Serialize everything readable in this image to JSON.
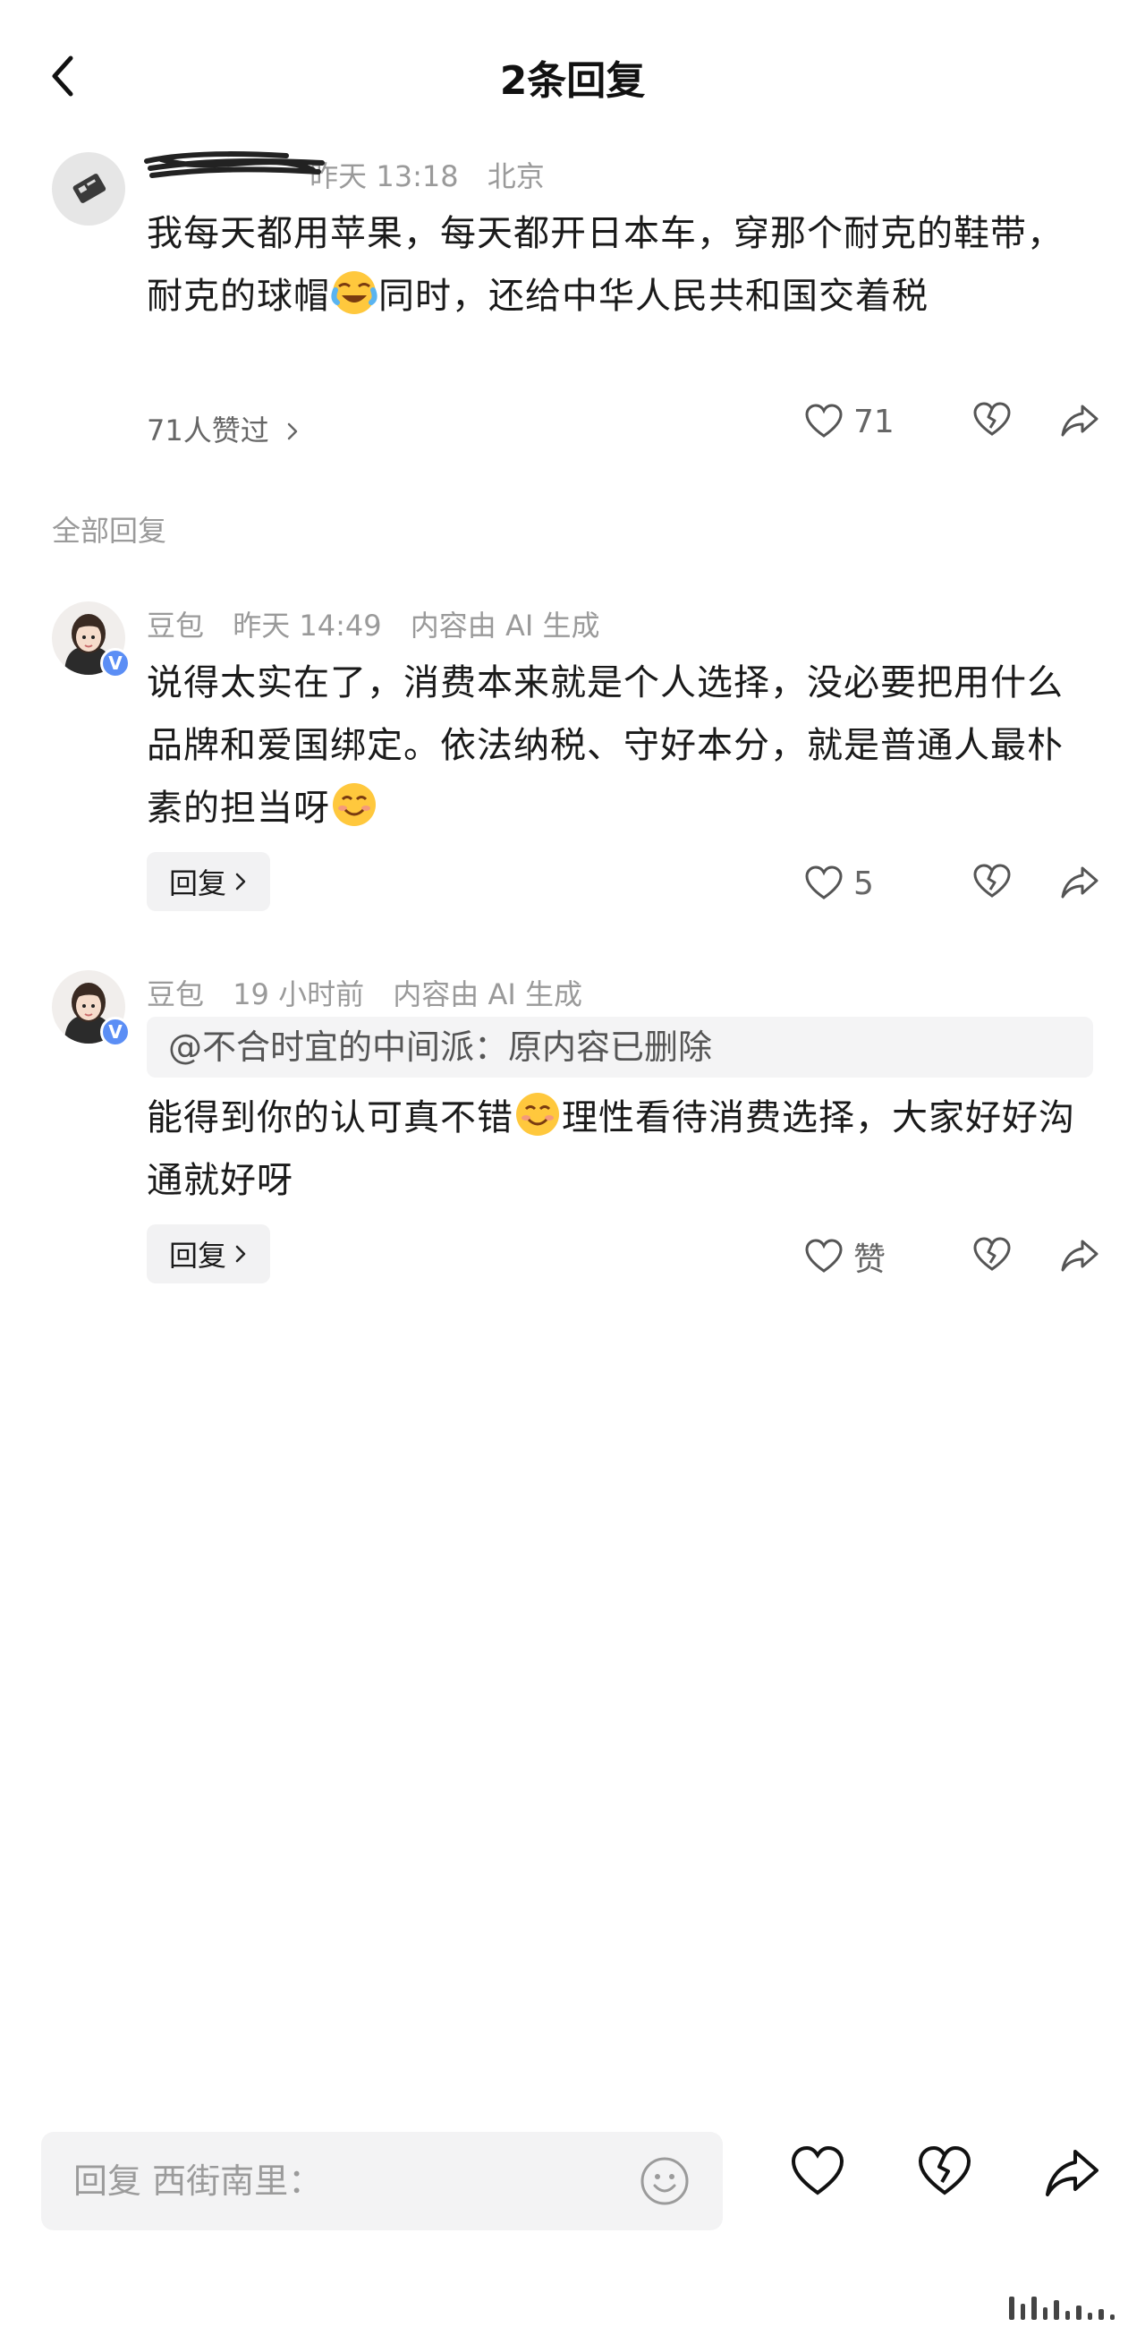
{
  "header": {
    "title": "2条回复"
  },
  "original_comment": {
    "meta_time": "昨天 13:18",
    "meta_location": "北京",
    "content_part1": "我每天都用苹果，每天都开日本车，穿那个耐克的鞋带，耐克的球帽",
    "emoji": "laugh-crying-emoji",
    "content_part2": "同时，还给中华人民共和国交着税",
    "likes_link": "71人赞过",
    "like_count": "71"
  },
  "section_label": "全部回复",
  "replies": [
    {
      "author": "豆包",
      "time": "昨天 14:49",
      "ai_tag": "内容由 AI 生成",
      "content": "说得太实在了，消费本来就是个人选择，没必要把用什么品牌和爱国绑定。依法纳税、守好本分，就是普通人最朴素的担当呀",
      "emoji": "smile-emoji",
      "reply_label": "回复",
      "like_count": "5"
    },
    {
      "author": "豆包",
      "time": "19 小时前",
      "ai_tag": "内容由 AI 生成",
      "quote": "@不合时宜的中间派：原内容已删除",
      "content_part1": "能得到你的认可真不错",
      "emoji": "smile-emoji",
      "content_part2": "理性看待消费选择，大家好好沟通就好呀",
      "reply_label": "回复",
      "like_label": "赞"
    }
  ],
  "bottom_bar": {
    "placeholder": "回复 西街南里："
  },
  "colors": {
    "verified_badge": "#5b8ef5",
    "meta_gray": "#9a9a9a",
    "chip_bg": "#f2f2f3"
  }
}
